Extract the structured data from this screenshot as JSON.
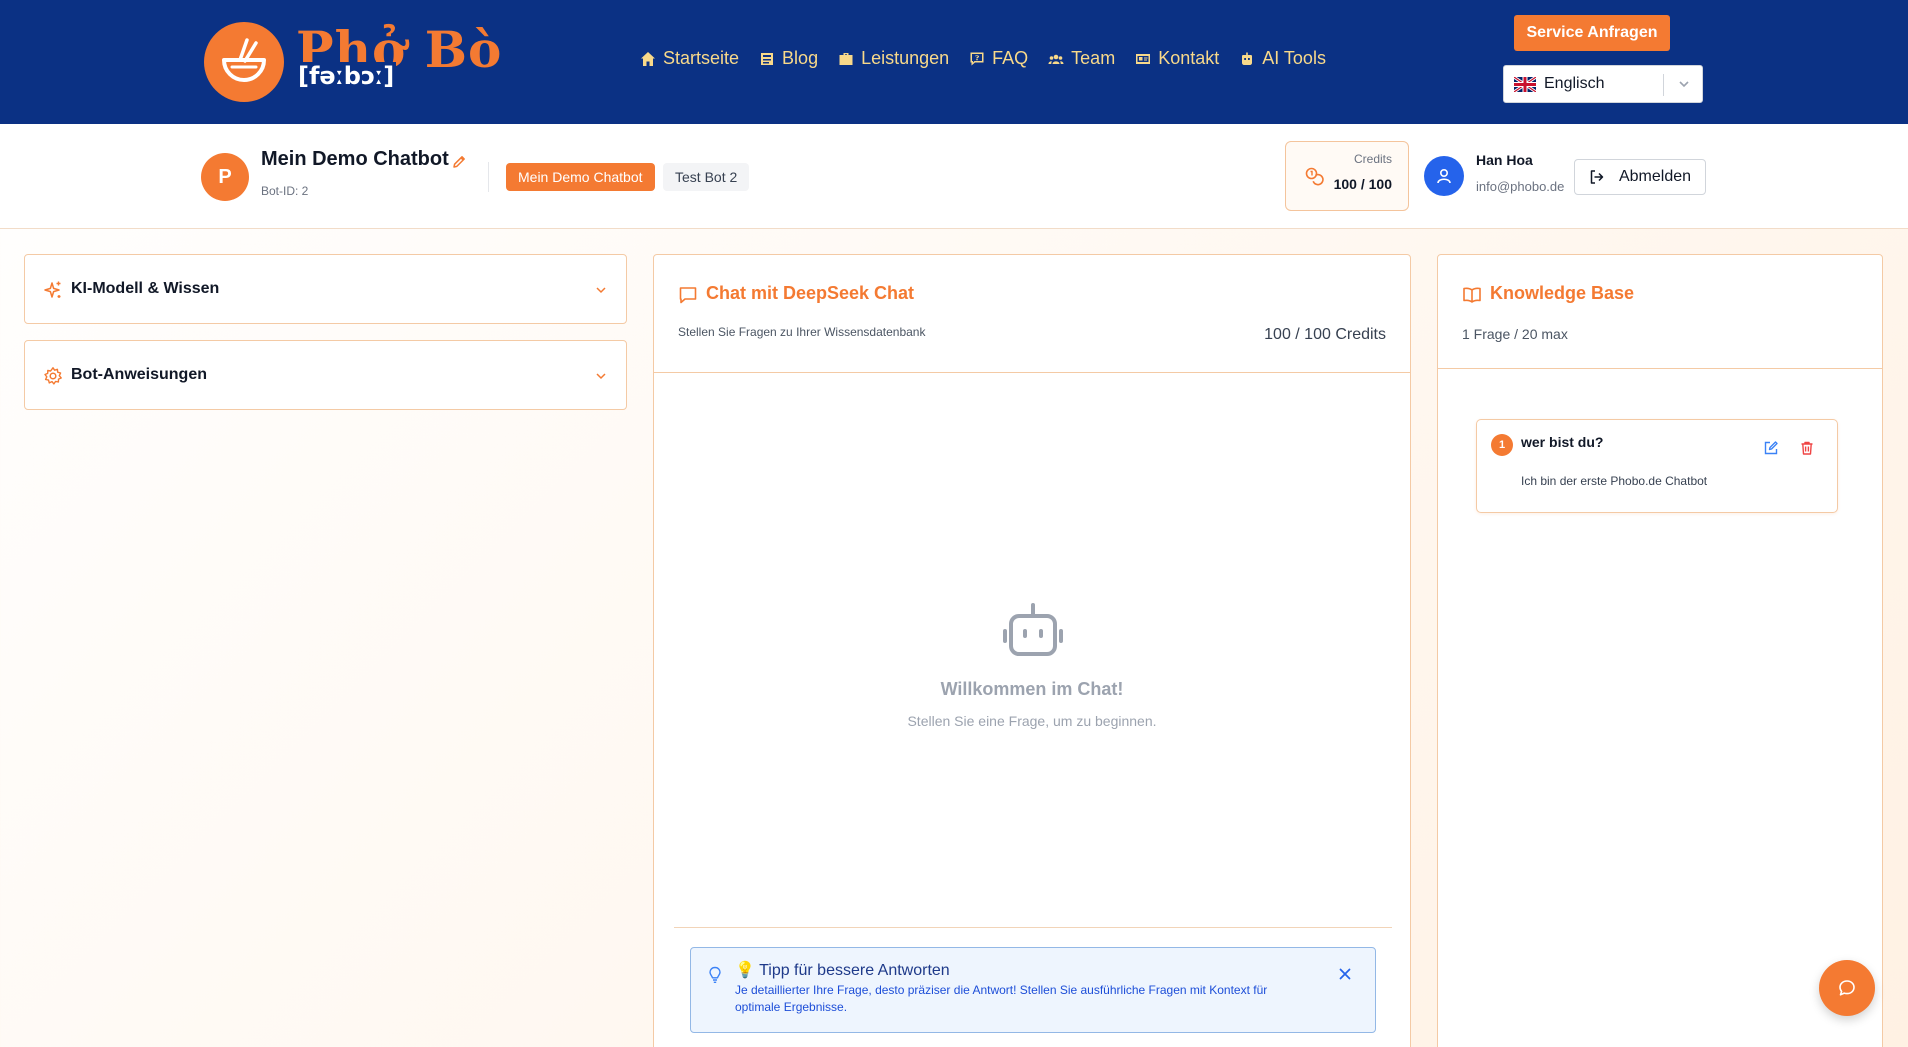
{
  "brand": {
    "name": "Phở Bò",
    "pronunciation": "[fəːbɔː]",
    "accent_color": "#f47a32",
    "nav_bg_color": "#0b3184"
  },
  "nav": {
    "links": [
      {
        "label": "Startseite",
        "icon": "home-icon"
      },
      {
        "label": "Blog",
        "icon": "blog-icon"
      },
      {
        "label": "Leistungen",
        "icon": "briefcase-icon"
      },
      {
        "label": "FAQ",
        "icon": "faq-icon"
      },
      {
        "label": "Team",
        "icon": "team-icon"
      },
      {
        "label": "Kontakt",
        "icon": "contact-card-icon"
      },
      {
        "label": "AI Tools",
        "icon": "robot-icon"
      }
    ],
    "service_button": "Service Anfragen",
    "language": "Englisch"
  },
  "bot": {
    "initial": "P",
    "name": "Mein Demo Chatbot",
    "id_label": "Bot-ID: 2",
    "tabs": [
      "Mein Demo Chatbot",
      "Test Bot 2"
    ]
  },
  "credits": {
    "label": "Credits",
    "value": "100 / 100"
  },
  "user": {
    "name": "Han Hoa",
    "email": "info@phobo.de",
    "logout": "Abmelden"
  },
  "accordions": [
    {
      "label": "KI-Modell & Wissen",
      "icon": "sparkles-icon"
    },
    {
      "label": "Bot-Anweisungen",
      "icon": "gear-icon"
    }
  ],
  "chat": {
    "title": "Chat mit DeepSeek Chat",
    "subtitle": "Stellen Sie Fragen zu Ihrer Wissensdatenbank",
    "credits": "100 / 100 Credits",
    "welcome_title": "Willkommen im Chat!",
    "welcome_sub": "Stellen Sie eine Frage, um zu beginnen.",
    "tip_title": "💡 Tipp für bessere Antworten",
    "tip_text": "Je detaillierter Ihre Frage, desto präziser die Antwort! Stellen Sie ausführliche Fragen mit Kontext für optimale Ergebnisse."
  },
  "knowledge_base": {
    "title": "Knowledge Base",
    "count": "1 Frage / 20 max",
    "items": [
      {
        "number": "1",
        "question": "wer bist du?",
        "answer": "Ich bin der erste Phobo.de Chatbot"
      }
    ]
  }
}
